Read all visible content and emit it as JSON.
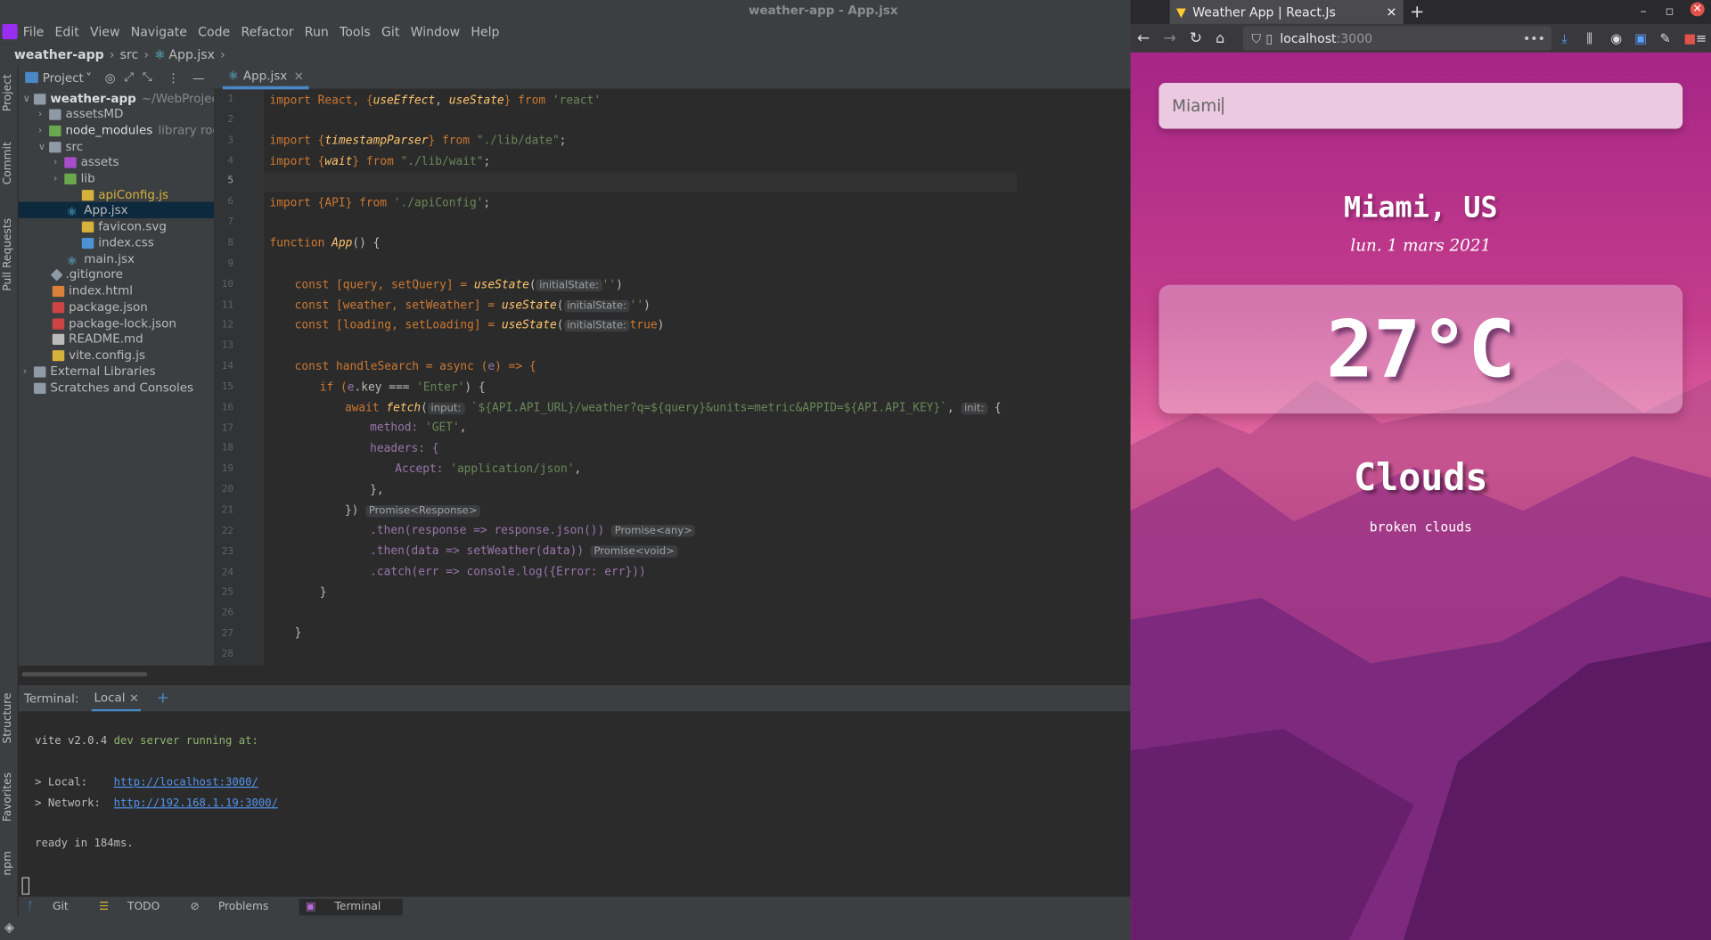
{
  "ide": {
    "window_title": "weather-app - App.jsx",
    "menu": [
      "File",
      "Edit",
      "View",
      "Navigate",
      "Code",
      "Refactor",
      "Run",
      "Tools",
      "Git",
      "Window",
      "Help"
    ],
    "breadcrumb": {
      "project": "weather-app",
      "folder": "src",
      "file": "App.jsx"
    },
    "side_tabs": [
      "Project",
      "Commit",
      "Pull Requests",
      "Structure",
      "Favorites",
      "npm"
    ],
    "project_dropdown": "Project",
    "tree": [
      {
        "name": "weather-app",
        "extra": "~/WebProjects"
      },
      {
        "name": "assetsMD"
      },
      {
        "name": "node_modules",
        "extra": "library root"
      },
      {
        "name": "src"
      },
      {
        "name": "assets"
      },
      {
        "name": "lib"
      },
      {
        "name": "apiConfig.js"
      },
      {
        "name": "App.jsx"
      },
      {
        "name": "favicon.svg"
      },
      {
        "name": "index.css"
      },
      {
        "name": "main.jsx"
      },
      {
        "name": ".gitignore"
      },
      {
        "name": "index.html"
      },
      {
        "name": "package.json"
      },
      {
        "name": "package-lock.json"
      },
      {
        "name": "README.md"
      },
      {
        "name": "vite.config.js"
      },
      {
        "name": "External Libraries"
      },
      {
        "name": "Scratches and Consoles"
      }
    ],
    "editor_tab": "App.jsx",
    "line_numbers": [
      "1",
      "2",
      "3",
      "4",
      "5",
      "6",
      "7",
      "8",
      "9",
      "10",
      "11",
      "12",
      "13",
      "14",
      "15",
      "16",
      "17",
      "18",
      "19",
      "20",
      "21",
      "22",
      "23",
      "24",
      "25",
      "26",
      "27",
      "28"
    ],
    "code": {
      "l1a": "import React, {",
      "l1b": "useEffect",
      "l1c": ", ",
      "l1d": "useState",
      "l1e": "} from ",
      "l1f": "'react'",
      "l3a": "import {",
      "l3b": "timestampParser",
      "l3c": "} from ",
      "l3d": "\"./lib/date\"",
      ";": ";",
      "l4a": "import {",
      "l4b": "wait",
      "l4c": "} from ",
      "l4d": "\"./lib/wait\"",
      "l6a": "import {API} from ",
      "l6b": "'./apiConfig'",
      "l8a": "function ",
      "l8b": "App",
      "l8c": "() {",
      "l10a": "const [query, setQuery] = ",
      "l10b": "useState",
      "l10h": "initialState:",
      "l10c": "''",
      "l11a": "const [weather, setWeather] = ",
      "l11b": "useState",
      "l11h": "initialState:",
      "l11c": "''",
      "l12a": "const [loading, setLoading] = ",
      "l12b": "useState",
      "l12h": "initialState:",
      "l12c": "true",
      "l14a": "const handleSearch = async (",
      "l14b": "e",
      ") => {": ") => {",
      "l15a": "if (",
      "l15b": "e",
      "l15c": ".key === ",
      "l15d": "'Enter'",
      "l15e": ") {",
      "l16a": "await ",
      "l16b": "fetch",
      "l16h": "input:",
      "l16c": "`${API.API_URL}/weather?q=${query}&units=metric&APPID=${API.API_KEY}`",
      "l16h2": "init:",
      "l16d": " {",
      "l17a": "method: ",
      "l17b": "'GET'",
      "l18a": "headers: {",
      "l19a": "Accept: ",
      "l19b": "'application/json'",
      "l20a": "},",
      "l21a": "})",
      "l21h": "Promise<Response>",
      "l22a": ".then(response => response.json())",
      "l22h": "Promise<any>",
      "l23a": ".then(data => setWeather(data))",
      "l23h": "Promise<void>",
      "l24a": ".catch(err => console.log({Error: err}))",
      "l25a": "}",
      "l27a": "}"
    },
    "terminal": {
      "label": "Terminal:",
      "tab": "Local",
      "line1a": "vite v2.0.4 ",
      "line1b": "dev server running at:",
      "local_label": "> Local:    ",
      "local_url": "http://localhost:3000/",
      "net_label": "> Network:  ",
      "net_url": "http://192.168.1.19:3000/",
      "ready": "ready in 184ms."
    },
    "status_tabs": [
      "Git",
      "TODO",
      "Problems",
      "Terminal"
    ]
  },
  "browser": {
    "tab_title": "Weather App | React.Js",
    "url_host": "localhost",
    "url_port": ":3000",
    "search_value": "Miami",
    "city": "Miami, US",
    "date": "lun. 1 mars 2021",
    "temperature": "27°C",
    "weather": "Clouds",
    "description": "broken clouds"
  },
  "colors": {
    "accent": "#4a88c7",
    "page_top": "#a62586",
    "page_bottom": "#6a1f6f"
  }
}
